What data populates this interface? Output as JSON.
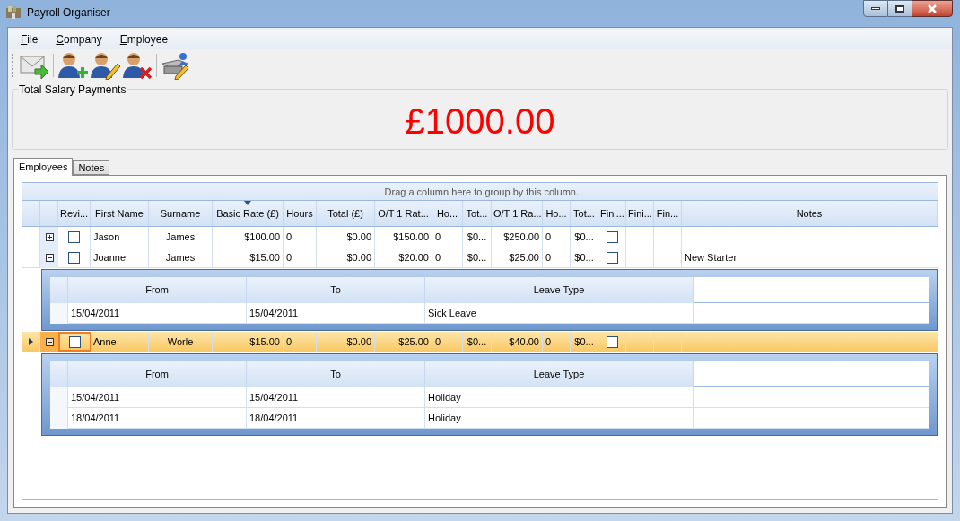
{
  "window": {
    "title": "Payroll Organiser"
  },
  "menu": [
    {
      "label": "File"
    },
    {
      "label": "Company"
    },
    {
      "label": "Employee"
    }
  ],
  "total": {
    "label": "Total Salary Payments",
    "value": "£1000.00"
  },
  "tabs": [
    {
      "label": "Employees",
      "selected": true
    },
    {
      "label": "Notes",
      "selected": false
    }
  ],
  "grid": {
    "group_hint": "Drag a column here to group by this column.",
    "columns": [
      {
        "label": "Revi...",
        "sorted": false
      },
      {
        "label": "First Name",
        "sorted": false
      },
      {
        "label": "Surname",
        "sorted": false
      },
      {
        "label": "Basic Rate (£)",
        "sorted": true
      },
      {
        "label": "Hours",
        "sorted": false
      },
      {
        "label": "Total (£)",
        "sorted": false
      },
      {
        "label": "O/T 1 Rat...",
        "sorted": false
      },
      {
        "label": "Ho...",
        "sorted": false
      },
      {
        "label": "Tot...",
        "sorted": false
      },
      {
        "label": "O/T 1 Ra...",
        "sorted": false
      },
      {
        "label": "Ho...",
        "sorted": false
      },
      {
        "label": "Tot...",
        "sorted": false
      },
      {
        "label": "Fini...",
        "sorted": false
      },
      {
        "label": "Fini...",
        "sorted": false
      },
      {
        "label": "Fin...",
        "sorted": false
      },
      {
        "label": "Notes",
        "sorted": false
      }
    ],
    "rows": [
      {
        "selected": false,
        "expanded": false,
        "reviewed": false,
        "finished": false,
        "values": [
          "Jason",
          "James",
          "$100.00",
          "0",
          "$0.00",
          "$150.00",
          "0",
          "$0...",
          "$250.00",
          "0",
          "$0..."
        ]
      },
      {
        "selected": false,
        "expanded": true,
        "reviewed": false,
        "finished": false,
        "values": [
          "Joanne",
          "James",
          "$15.00",
          "0",
          "$0.00",
          "$20.00",
          "0",
          "$0...",
          "$25.00",
          "0",
          "$0..."
        ],
        "notes": "New Starter",
        "leave": {
          "columns": [
            "From",
            "To",
            "Leave Type"
          ],
          "rows": [
            [
              "15/04/2011",
              "15/04/2011",
              "Sick Leave"
            ]
          ]
        }
      },
      {
        "selected": true,
        "expanded": true,
        "reviewed": false,
        "finished": false,
        "values": [
          "Anne",
          "Worle",
          "$15.00",
          "0",
          "$0.00",
          "$25.00",
          "0",
          "$0...",
          "$40.00",
          "0",
          "$0..."
        ],
        "leave": {
          "columns": [
            "From",
            "To",
            "Leave Type"
          ],
          "rows": [
            [
              "15/04/2011",
              "15/04/2011",
              "Holiday"
            ],
            [
              "18/04/2011",
              "18/04/2011",
              "Holiday"
            ]
          ]
        }
      }
    ]
  }
}
